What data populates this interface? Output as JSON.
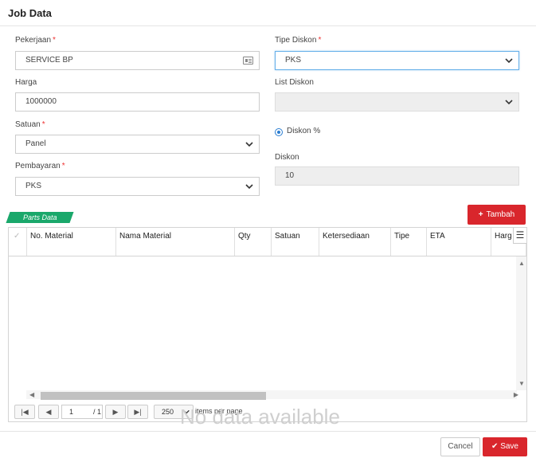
{
  "header": {
    "title": "Job Data"
  },
  "form": {
    "pekerjaan": {
      "label": "Pekerjaan",
      "required": "*",
      "value": "SERVICE BP",
      "icon": "id-card-icon"
    },
    "harga": {
      "label": "Harga",
      "value": "1000000"
    },
    "satuan": {
      "label": "Satuan",
      "required": "*",
      "value": "Panel"
    },
    "pembayaran": {
      "label": "Pembayaran",
      "required": "*",
      "value": "PKS"
    },
    "tipe_diskon": {
      "label": "Tipe Diskon",
      "required": "*",
      "value": "PKS"
    },
    "list_diskon": {
      "label": "List Diskon",
      "value": ""
    },
    "diskon_radio": {
      "label": "Diskon %",
      "selected": true
    },
    "diskon": {
      "label": "Diskon",
      "value": "10"
    }
  },
  "parts": {
    "tag": "Parts Data",
    "add_button": "Tambah",
    "columns": [
      "No. Material",
      "Nama Material",
      "Qty",
      "Satuan",
      "Ketersediaan",
      "Tipe",
      "ETA",
      "Harg"
    ],
    "empty_text": "No data available",
    "pager": {
      "page": "1",
      "of_text": "/ 1",
      "page_size": "250",
      "items_text": "items per page",
      "first": "|◀",
      "prev": "◀",
      "next": "▶",
      "last": "▶|"
    }
  },
  "footer": {
    "cancel": "Cancel",
    "save": "Save"
  },
  "colors": {
    "accent_red": "#d9262c",
    "tag_green": "#1aa86b",
    "radio_blue": "#2a7dd1"
  }
}
